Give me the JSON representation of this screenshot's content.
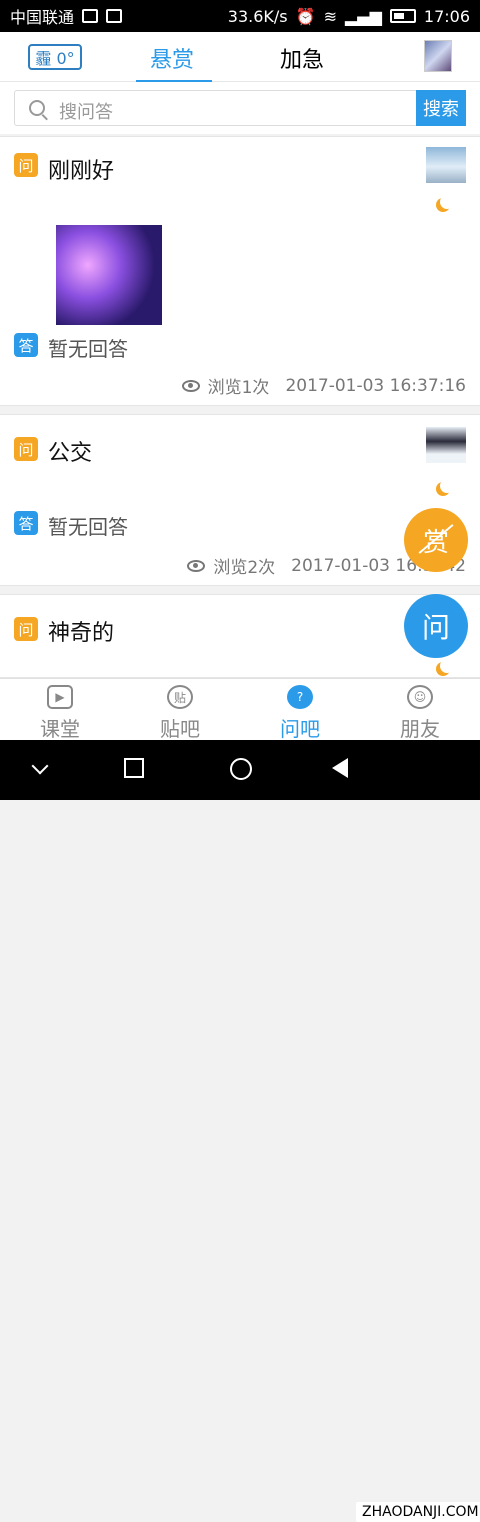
{
  "status_bar": {
    "carrier": "中国联通",
    "speed": "33.6K/s",
    "time": "17:06"
  },
  "topbar": {
    "weather": "霾 0°",
    "tabs": [
      {
        "label": "悬赏",
        "active": true
      },
      {
        "label": "加急",
        "active": false
      }
    ]
  },
  "search": {
    "placeholder": "搜问答",
    "button_label": "搜索"
  },
  "posts": [
    {
      "question_badge": "问",
      "title": "刚刚好",
      "answer_badge": "答",
      "answer": "暂无回答",
      "views": "浏览1次",
      "timestamp": "2017-01-03 16:37:16"
    },
    {
      "question_badge": "问",
      "title": "公交",
      "answer_badge": "答",
      "answer": "暂无回答",
      "views": "浏览2次",
      "timestamp": "2017-01-03 16:3..42"
    },
    {
      "question_badge": "问",
      "title": "神奇的"
    }
  ],
  "fabs": {
    "reward": "赏",
    "ask": "问"
  },
  "bottom_nav": [
    {
      "label": "课堂",
      "icon_glyph": "▶",
      "active": false
    },
    {
      "label": "贴吧",
      "icon_glyph": "贴",
      "active": false
    },
    {
      "label": "问吧",
      "icon_glyph": "?",
      "active": true
    },
    {
      "label": "朋友",
      "icon_glyph": "☺",
      "active": false
    }
  ],
  "watermark": "ZHAODANJI.COM",
  "colors": {
    "accent": "#2b9be9",
    "question": "#f5a623",
    "answer": "#2b9be9"
  }
}
